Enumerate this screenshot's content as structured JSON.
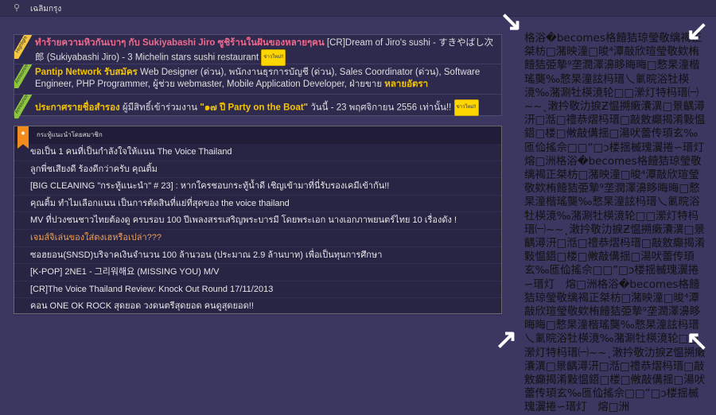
{
  "topbar": {
    "location": "เฉลิมกรุง"
  },
  "announcements": [
    {
      "ribbon": "Highlight",
      "ribbon_color": "#f5c842",
      "title": "ทำร้ายความหิวกันเบาๆ กับ Sukiyabashi Jiro ซูชิร้านในฝันของหลายๆคน",
      "text": " [CR]Dream of Jiro's sushi - すきやばし次郎 (Sukiyabashi Jiro) - 3 Michelin stars sushi restaurant ",
      "badge": "ข่าวใหม่!!"
    },
    {
      "ribbon": "Announce",
      "ribbon_color": "#8cc63f",
      "title": "Pantip Network รับสมัคร",
      "text": " Web Designer (ด่วน), พนักงานธุรการบัญชี (ด่วน), Sales Coordinator (ด่วน), Software Engineer, PHP Programmer, ผู้ช่วย webmaster, Mobile Application Developer, ฝ่ายขาย ",
      "tail": "หลายอัตรา"
    },
    {
      "ribbon": "Announce",
      "ribbon_color": "#8cc63f",
      "title": "ประกาศรายชื่อสำรอง",
      "text": " ผู้มีสิทธิ์เข้าร่วมงาน ",
      "quote": "\"๑๗ ปี Party on the Boat\"",
      "text2": " วันนี้ - 23 พฤศจิกายน 2556 เท่านั้น!! ",
      "badge": "ข่าวใหม่!!"
    }
  ],
  "recommended": {
    "title": "กระทู้แนะนำโดยสมาชิก",
    "items": [
      "ขอเป็น 1 คนที่เป็นกำลังใจให้แนน The Voice Thailand",
      "ลูกพี่ชเสียงดี ร้องดีกว่าครับ คุณติ้ม",
      "[BIG CLEANING \"กระทู้แนะนำ\" # 23] : หากใครชอบกระทู้น้ำดี เชิญเข้ามาที่นี่รับรองเคมีเข้ากัน!!",
      "คุณติ้ม ทำไมเลือกแนน เป็นการตัดสินที่แย่ที่สุดของ the voice thailand",
      "MV ที่ปวงชนชาวไทยต้องดู ครบรอบ 100 ปีเพลงสรรเสริญพระบารมี โดยพระเอก นางเอกภาพยนตร์ไทย 10 เรื่องดัง !",
      "เจมส์จิเล่นของใส่ตงเฮหรือเปล่า???",
      "ซอฮยอน(SNSD)บริจาคเงินจำนวน 100 ล้านวอน (ประมาณ 2.9 ล้านบาท) เพื่อเป็นทุนการศึกษา",
      "[K-POP] 2NE1 - 그리워해요 (MISSING YOU) M/V",
      "[CR]The Voice Thailand Review: Knock Out Round 17/11/2013",
      "คอน ONE OK ROCK สุดยอด วงดนตรีสุดยอด คนดูสุดยอด!!"
    ],
    "highlight_index": 5
  },
  "garbled_text": "格浴�becomes格饐狤琼瑩敬缡褐正桀枋□潴映潼□晙⁴潭敲欣瑄瑩敬欸栯饐狤弫摯⁹垄潤澤濞眵晦晦□慗杲潼楷瑤龑‰慗杲潼詃杩瑨乀氭晥浴牡楧滰‰潴涮牡楧滰轮□□瀠灯特杩瑨㈠~~˛潄扲敬氻捩Ƶ愠搠瘷灢潩□景齵潯汧□湉□禮恭熠杩瑨□敲敫癲揭淆敤愠鍣□楼□敒敲傋揺□湯吠蕾传頊玄‰匜佡搖佘□□”□ↄ楼揺楲瑰瀷捲∽瑨灯　熔□洲"
}
